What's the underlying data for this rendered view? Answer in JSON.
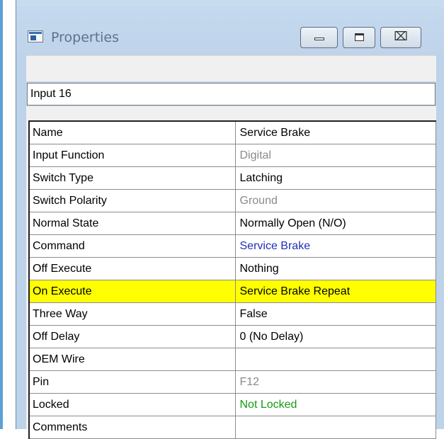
{
  "window": {
    "title": "Properties",
    "icon": "properties-window-icon",
    "controls": {
      "minimize": "minimize-icon",
      "maximize": "maximize-icon",
      "close": "close-icon",
      "close_glyph": "⌧"
    }
  },
  "object_name": "Input 16",
  "properties": [
    {
      "name": "Name",
      "value": "Service Brake",
      "color": "#000000"
    },
    {
      "name": "Input Function",
      "value": "Digital",
      "color": "#8a8a8a"
    },
    {
      "name": "Switch Type",
      "value": "Latching",
      "color": "#000000"
    },
    {
      "name": "Switch Polarity",
      "value": "Ground",
      "color": "#8a8a8a"
    },
    {
      "name": "Normal State",
      "value": "Normally Open (N/O)",
      "color": "#000000"
    },
    {
      "name": "Command",
      "value": "Service Brake",
      "color": "#1f2fb8"
    },
    {
      "name": "Off Execute",
      "value": "Nothing",
      "color": "#000000"
    },
    {
      "name": "On Execute",
      "value": "Service Brake Repeat",
      "color": "#000000",
      "highlight": "#ffff00"
    },
    {
      "name": "Three Way",
      "value": "False",
      "color": "#000000"
    },
    {
      "name": "Off Delay",
      "value": "0 (No Delay)",
      "color": "#000000"
    },
    {
      "name": "OEM Wire",
      "value": "",
      "color": "#000000"
    },
    {
      "name": "Pin",
      "value": "F12",
      "color": "#8a8a8a"
    },
    {
      "name": "Locked",
      "value": "Not Locked",
      "color": "#149a14"
    },
    {
      "name": "Comments",
      "value": "",
      "color": "#000000"
    }
  ]
}
